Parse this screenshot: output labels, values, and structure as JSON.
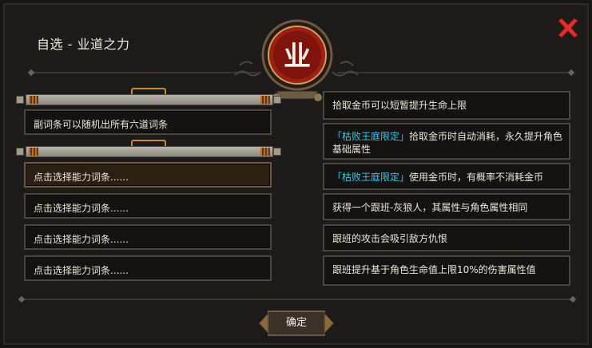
{
  "window": {
    "title": "自选 - 业道之力",
    "emblem_glyph": "业"
  },
  "left_panel": {
    "info_text": "副词条可以随机出所有六道词条",
    "slots": [
      {
        "label": "点击选择能力词条......",
        "selected": true
      },
      {
        "label": "点击选择能力词条......",
        "selected": false
      },
      {
        "label": "点击选择能力词条......",
        "selected": false
      },
      {
        "label": "点击选择能力词条......",
        "selected": false
      }
    ]
  },
  "right_panel": {
    "abilities": [
      {
        "tag": "",
        "text": "拾取金币可以短暂提升生命上限"
      },
      {
        "tag": "「枯败王庭限定」",
        "text": "拾取金币时自动消耗，永久提升角色基础属性"
      },
      {
        "tag": "「枯败王庭限定」",
        "text": "使用金币时，有概率不消耗金币"
      },
      {
        "tag": "",
        "text": "获得一个跟班-灰狼人，其属性与角色属性相同"
      },
      {
        "tag": "",
        "text": "跟班的攻击会吸引敌方仇恨"
      },
      {
        "tag": "",
        "text": "跟班提升基于角色生命值上限10%的伤害属性值"
      }
    ]
  },
  "footer": {
    "confirm_label": "确定"
  },
  "colors": {
    "accent_tag": "#36c8e6",
    "close_red": "#e0302a",
    "emblem_red": "#9c1f14"
  }
}
